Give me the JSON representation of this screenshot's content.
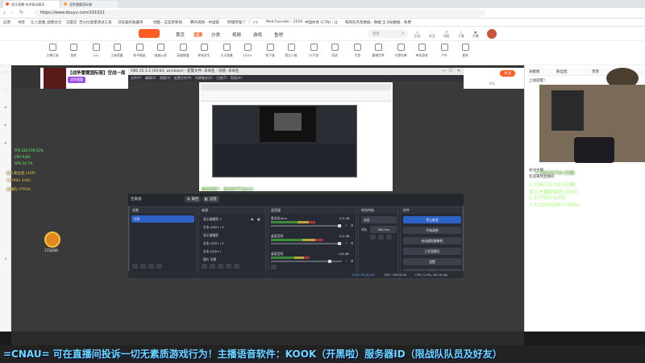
{
  "browser": {
    "tabs": [
      {
        "title": "虎牙直播-技术驱动娱乐",
        "color": "#ff5d23"
      },
      {
        "title": "战争雷霆国际服",
        "color": "#ff9a23"
      }
    ],
    "url": "https://www.douyu.com/101021",
    "bookmarks": [
      "应用",
      "书签",
      "让人直播_视频主页",
      "迅雷云",
      "百分比能量测试工具",
      "浏览器的收藏夹",
      "优酷 - 这是更新视",
      "腾讯视频 - 中国第",
      "哔哩哔哩 (゜-゜)つ",
      "Mod Founder - 2019",
      "中国体育 (CTN) - 让",
      "每周任务及数据 - 数据",
      "全 B站数据 - 免费"
    ]
  },
  "site": {
    "nav": [
      "首页",
      "直播",
      "分类",
      "视频",
      "游戏",
      "鱼吧"
    ],
    "active_nav": "直播",
    "search_placeholder": "搜索",
    "header_icons": [
      "历史",
      "关注",
      "消息",
      "下载",
      "开播"
    ],
    "categories": [
      "主播订阅",
      "鱼吧",
      "LOL",
      "王者荣耀",
      "和平精英",
      "穿越火线",
      "英雄联盟",
      "绝地求生",
      "天天直播",
      "DOTA",
      "地下城",
      "第五人格",
      "CF手游",
      "奇迹",
      "手游",
      "魔兽世界",
      "守望先锋",
      "单机游戏",
      "户外",
      "更多"
    ]
  },
  "room": {
    "title": "【战争雷霆国际服】空战一局",
    "tag": "战争雷霆",
    "follow_button": "关注",
    "report": "举报"
  },
  "obs": {
    "title": "OBS 25.1.2 (64-bit, windows) - 配置文件: 未命名 - 场景: 未命名",
    "menu": [
      "文件(F)",
      "编辑(E)",
      "视图(V)",
      "配置文件(P)",
      "场景集合(S)",
      "工具(T)",
      "帮助(H)"
    ],
    "scene_bar": "无来源",
    "scene_bar_buttons": [
      "属性",
      "滤镜"
    ],
    "docks": {
      "scenes": {
        "title": "场景",
        "items": [
          "场景"
        ]
      },
      "sources": {
        "title": "来源",
        "items": [
          "显示器捕获 2",
          "文本 (GDI+) 3",
          "显示器捕获",
          "文本 (GDI+) 2",
          "文本 (GDI+)",
          "图片 场景"
        ]
      },
      "mixer": {
        "title": "混音器",
        "channels": [
          {
            "name": "麦克风/Aux",
            "db": "0.0 dB",
            "level": 0.62
          },
          {
            "name": "桌面音频",
            "db": "0.0 dB",
            "level": 0.74
          },
          {
            "name": "桌面音频",
            "db": "-3.6 dB",
            "level": 0.55
          }
        ]
      },
      "transitions": {
        "title": "转场特效",
        "type": "淡出",
        "duration_label": "时长",
        "duration": "300 ms"
      },
      "controls": {
        "title": "控件",
        "buttons": [
          "停止推流",
          "开始录制",
          "启动虚拟摄像机",
          "工作室模式",
          "设置",
          "退出"
        ]
      }
    },
    "status": {
      "live": "LIVE: 00:00:00",
      "rec": "REC: 00:00:00",
      "cpu": "CPU: 0.9%, 60.00 fps"
    }
  },
  "hud": {
    "lines": [
      "FPS  240  CPU  52%",
      "CPU  9.8%",
      "GPU  24.7%"
    ],
    "viewers": "173/206"
  },
  "right_panel": {
    "tabs": [
      "贡献榜",
      "粉丝团",
      "贵宾"
    ],
    "chat": [
      "上线提醒！",
      "关注主播",
      "欢迎来到直播间",
      "1.338155719 (已满)",
      "加入主播粉丝团 (XSP)",
      "1.327992 (LYB)",
      "1.722693299 (YYDS)"
    ]
  },
  "danmu": [
    "尊贵的用户，请勿进行不当言论！",
    "1.338155719 (已满)",
    "加入粉丝团 (XSP)",
    "127992 (LYB)",
    "主播的 (YYDS)"
  ],
  "ticker": "=CNAU= 可在直播间投诉一切无素质游戏行为！主播语音软件：KOOK（开黑啦）服务器ID（限战队队员及好友）"
}
